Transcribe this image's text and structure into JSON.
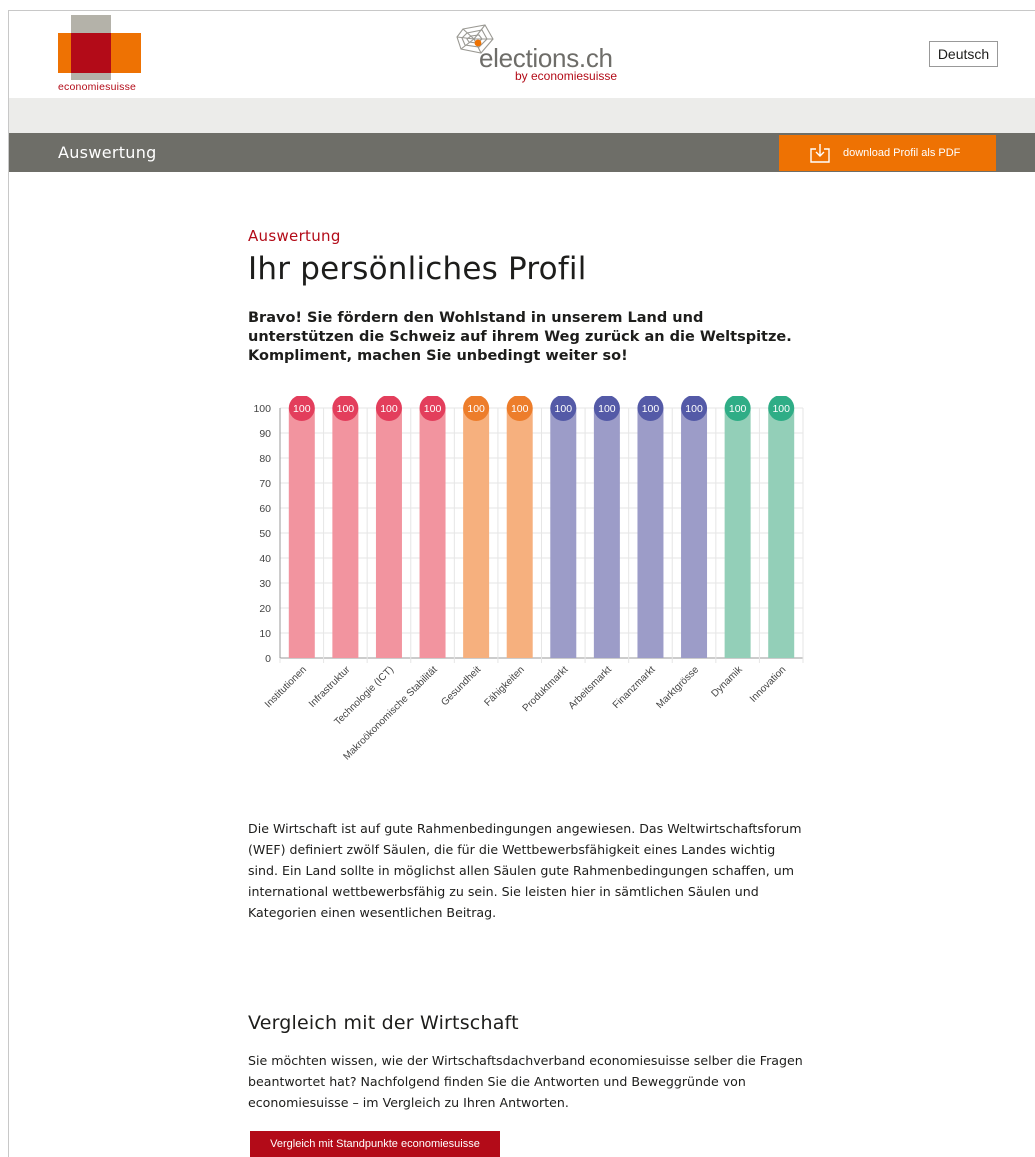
{
  "header": {
    "brand_left": "economiesuisse",
    "brand_center_main": "elections.ch",
    "brand_center_sub": "by economiesuisse",
    "language_button": "Deutsch",
    "colors": {
      "red": "#b30b18",
      "orange": "#ee7203",
      "gray": "#b4b2a9",
      "navbar": "#6e6e68"
    }
  },
  "navbar": {
    "title": "Auswertung",
    "download_button": "download Profil als PDF",
    "download_icon": "download-icon"
  },
  "main": {
    "eyebrow": "Auswertung",
    "title": "Ihr persönliches Profil",
    "lead": "Bravo! Sie fördern den Wohlstand in unserem Land und unterstützen die Schweiz auf ihrem Weg zurück an die Weltspitze. Kompliment, machen Sie unbedingt weiter so!",
    "body": "Die Wirtschaft ist auf gute Rahmenbedingungen angewiesen. Das Weltwirtschaftsforum (WEF) definiert zwölf Säulen, die für die Wettbewerbsfähigkeit eines Landes wichtig sind. Ein Land sollte in möglichst allen Säulen gute Rahmenbedingungen schaffen, um international wettbewerbsfähig zu sein. Sie leisten hier in sämtlichen Säulen und Kategorien einen wesentlichen Beitrag.",
    "compare_title": "Vergleich mit der Wirtschaft",
    "compare_body": "Sie möchten wissen, wie der Wirtschaftsdachverband economiesuisse selber die Fragen beantwortet hat? Nachfolgend finden Sie die Antworten und Beweggründe von economiesuisse – im Vergleich zu Ihren Antworten.",
    "compare_button": "Vergleich mit Standpunkte economiesuisse"
  },
  "chart_data": {
    "type": "bar",
    "categories": [
      "Institutionen",
      "Infrastruktur",
      "Technologie (ICT)",
      "Makroökonomische Stabilität",
      "Gesundheit",
      "Fähigkeiten",
      "Produktmarkt",
      "Arbeitsmarkt",
      "Finanzmarkt",
      "Marktgrösse",
      "Dynamik",
      "Innovation"
    ],
    "values": [
      100,
      100,
      100,
      100,
      100,
      100,
      100,
      100,
      100,
      100,
      100,
      100
    ],
    "value_labels": [
      "100",
      "100",
      "100",
      "100",
      "100",
      "100",
      "100",
      "100",
      "100",
      "100",
      "100",
      "100"
    ],
    "bar_colors": [
      "#f2949f",
      "#f2949f",
      "#f2949f",
      "#f2949f",
      "#f6b07e",
      "#f6b07e",
      "#9c9cc8",
      "#9c9cc8",
      "#9c9cc8",
      "#9c9cc8",
      "#93cfb8",
      "#93cfb8"
    ],
    "badge_colors": [
      "#e33e5c",
      "#e33e5c",
      "#e33e5c",
      "#e33e5c",
      "#ed7d2b",
      "#ed7d2b",
      "#545aa7",
      "#545aa7",
      "#545aa7",
      "#545aa7",
      "#2fad86",
      "#2fad86"
    ],
    "yticks": [
      "0",
      "10",
      "20",
      "30",
      "40",
      "50",
      "60",
      "70",
      "80",
      "90",
      "100"
    ],
    "ylim": [
      0,
      100
    ],
    "grid": true,
    "title": "",
    "xlabel": "",
    "ylabel": ""
  }
}
